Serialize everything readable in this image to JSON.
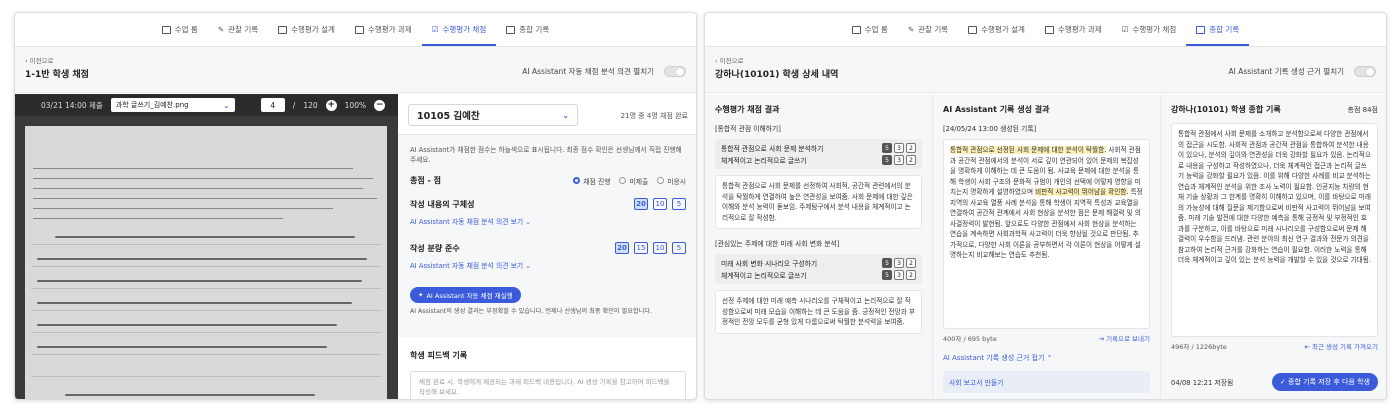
{
  "nav": {
    "tabs": [
      {
        "label": "수업 룸",
        "icon": "classroom-icon"
      },
      {
        "label": "관찰 기록",
        "icon": "pen-icon"
      },
      {
        "label": "수행평가 설계",
        "icon": "checklist-icon"
      },
      {
        "label": "수행평가 과제",
        "icon": "assignment-icon"
      },
      {
        "label": "수행평가 채점",
        "icon": "grading-icon"
      },
      {
        "label": "종합 기록",
        "icon": "record-icon"
      }
    ]
  },
  "left": {
    "active_tab": "수행평가 채점",
    "back": "이전으로",
    "title": "1-1반 학생 채점",
    "toggle_label": "AI Assistant 자동 채점 분석 의견 펼치기",
    "viewer": {
      "submitted": "03/21 14:00 제출",
      "file": "과학 글쓰기_김예찬.png",
      "page": "4",
      "total": "120",
      "zoom": "100%"
    },
    "student": "10105 김예찬",
    "count": "21명 중 4명 채점 완료",
    "note": "AI Assistant가 채점한 점수는 하늘색으로 표시됩니다. 최종 점수 확인은 선생님께서 직접 진행해 주세요.",
    "total_label": "총점 - 점",
    "radios": [
      "채점 진행",
      "미제출",
      "미응시"
    ],
    "criteria": [
      {
        "label": "작성 내용의 구체성",
        "scores": [
          "20",
          "10",
          "5"
        ],
        "selected": 0,
        "link": "AI Assistant 자동 채점 분석 의견 보기"
      },
      {
        "label": "작성 분량 준수",
        "scores": [
          "20",
          "15",
          "10",
          "5"
        ],
        "selected": 0,
        "link": "AI Assistant 자동 채점 분석 의견 보기"
      }
    ],
    "ai_button": "AI Assistant 자동 채점 재실행",
    "ai_note": "AI Assistant의 생성 결과는 부정확할 수 있습니다. 언제나 선생님의 최종 확인이 필요합니다.",
    "feedback_title": "학생 피드백 기록",
    "feedback_placeholder": "채점 완료 시, 학생에게 제공되는 과제 피드백 내용입니다. AI 생성 기록을 참고하여 피드백을 작성해 보세요."
  },
  "right": {
    "active_tab": "종합 기록",
    "back": "이전으로",
    "title": "강하나(10101) 학생 상세 내역",
    "toggle_label": "AI Assistant 기록 생성 근거 펼치기",
    "col1": {
      "title": "수행평가 채점 결과",
      "sections": [
        {
          "name": "[통합적 관점 이해하기]",
          "criteria": [
            {
              "label": "통합적 관점으로 사회 문제 분석하기",
              "scores": [
                "5",
                "3",
                "2"
              ],
              "selected": 0
            },
            {
              "label": "체계적이고 논리적으로 글쓰기",
              "scores": [
                "5",
                "3",
                "2"
              ],
              "selected": 0
            }
          ],
          "text": "통합적 관점으로 사회 문제를 선정하여 사회적, 공간적 관련에서의 분석을 탁월하게 연결하여 높은 연관성을 보여줌. 사회 문제에 대한 깊은 이해와 분석 능력이 돋보임. 주제탐구에서 분석 내용을 체계적이고 논리적으로 잘 작성함."
        },
        {
          "name": "[관심있는 주제에 대한 미래 사회 변화 분석]",
          "criteria": [
            {
              "label": "미래 사회 변화 시나리오 구성하기",
              "scores": [
                "5",
                "3",
                "2"
              ],
              "selected": 0
            },
            {
              "label": "체계적이고 논리적으로 글쓰기",
              "scores": [
                "5",
                "3",
                "2"
              ],
              "selected": 0
            }
          ],
          "text": "선정 주제에 대한 미래 예측 시나리오를 구체적이고 논리적으로 잘 작성함으로써 미래 모습을 이해하는 데 큰 도움을 줌. 긍정적인 전망과 부정적인 전망 모두를 균형 있게 다룸으로써 탁월한 분석력을 보여줌."
        }
      ]
    },
    "col2": {
      "title": "AI Assistant 기록 생성 결과",
      "generated": "[24/05/24 13:00 생성된 기록]",
      "text_hl1": "통합적 관점으로 선정된 사회 문제에 대한 분석이 탁월함.",
      "text_a": " 사회적 관점과 공간적 관점에서의 분석이 서로 깊이 연관되어 있어 문제의 복잡성을 명확하게 이해하는 데 큰 도움이 됨. 사교육 문제에 대한 분석을 통해 학생이 사회 구조와 문화적 규범이 개인의 선택에 어떻게 영향을 미치는지 명확하게 설명하였으며 ",
      "text_hl2": "비판적 사고력이 뛰어남을 확인함.",
      "text_b": " 특정 지역의 사교육 열풍 사례 분석을 통해 학생이 지역적 특성과 교육열을 연결하여 공간적 관계에서 사회 현상을 분석한 점은 문제 해결력 및 의사결정력이 발현됨. 앞으로도 다양한 관점에서 사회 현상을 분석하는 연습을 계속하면 사회과학적 사고력이 더욱 향상될 것으로 판단됨. 추가적으로, 다양한 사회 이론을 공부하면서 각 이론이 현상을 어떻게 설명하는지 비교해보는 연습도 추천됨.",
      "bytes": "400자 / 695 byte",
      "move": "기록으로 보내기",
      "fold": "AI Assistant 기록 생성 근거 접기",
      "basis": "사회 보고서 만들기"
    },
    "col3": {
      "title": "강하나(10101) 학생 종합 기록",
      "total": "총점 84점",
      "text": "통합적 관점에서 사회 문제를 소개하고 분석함으로써 다양한 관점에서의 접근을 시도함. 사회적 관점과 공간적 관점을 통합하여 분석한 내용이 있으나, 분석의 깊이와 연관성을 더욱 강화할 필요가 있음. 논리적으로 내용을 구성하고 작성하였으나, 더욱 체계적인 접근과 논리적 글쓰기 능력을 강화할 필요가 있음. 이를 위해 다양한 사례를 비교 분석하는 연습과 체계적인 분석을 위한 조사 노력이 필요함. 인공지능 차량의 현재 기술 상황과 그 한계를 명확히 이해하고 있으며, 이를 바탕으로 미래의 가능성에 대해 질문을 제기함으로써 비판적 사고력이 뛰어남을 보여줌. 미래 기술 발전에 대한 다양한 예측을 통해 긍정적 및 부정적인 효과를 구분하고, 이를 바탕으로 미래 시나리오를 구성함으로써 문제 해결력이 우수함을 드러냄. 관련 분야의 최신 연구 결과와 전문가 의견을 참고하여 논리적 근거를 강화하는 연습이 필요함. 이러한 노력을 통해 더욱 체계적이고 깊이 있는 분석 능력을 개발할 수 있을 것으로 기대됨.",
      "bytes": "496자 / 1226byte",
      "recent": "최근 생성 기록 가져오기",
      "saved": "04/08 12:21 저장됨",
      "save_button": "종합 기록 저장 후 다음 학생"
    }
  }
}
